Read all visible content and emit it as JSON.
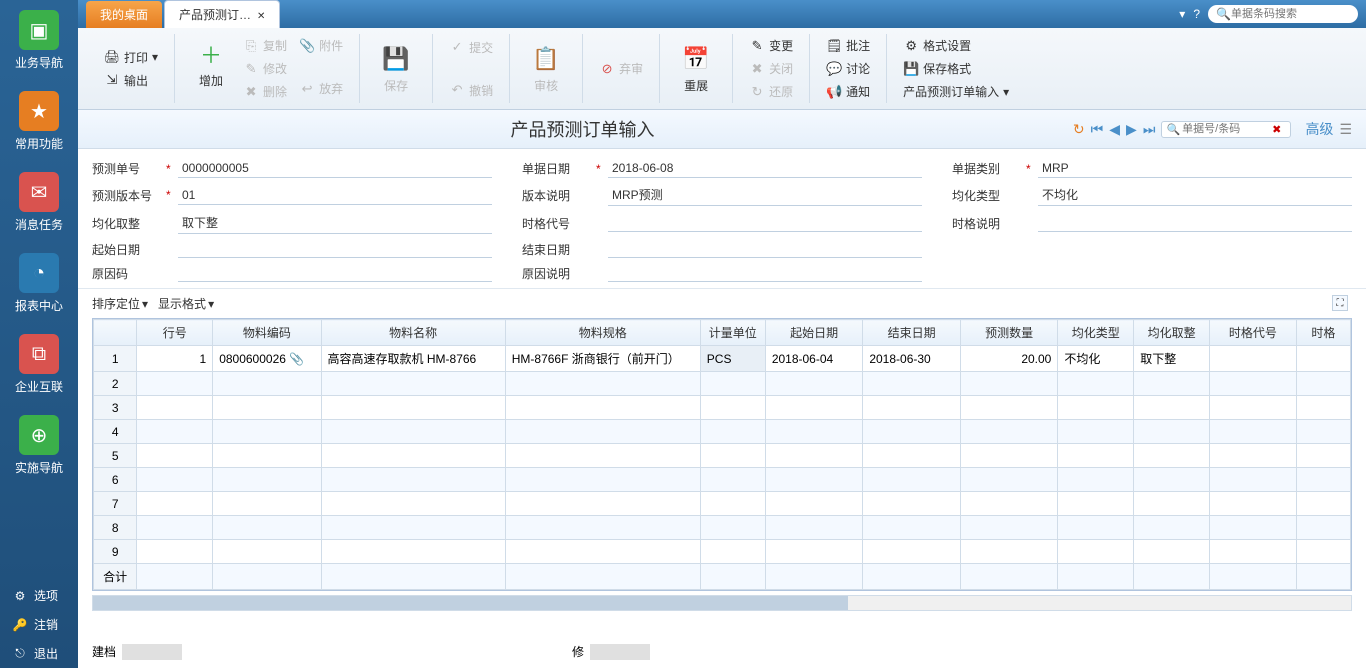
{
  "sidebar": {
    "items": [
      {
        "label": "业务导航",
        "color": "#3bb04a"
      },
      {
        "label": "常用功能",
        "color": "#e67e22"
      },
      {
        "label": "消息任务",
        "color": "#d9534f"
      },
      {
        "label": "报表中心",
        "color": "#2a7ab0"
      },
      {
        "label": "企业互联",
        "color": "#d9534f"
      },
      {
        "label": "实施导航",
        "color": "#3bb04a"
      }
    ],
    "bottom": [
      {
        "label": "选项"
      },
      {
        "label": "注销"
      },
      {
        "label": "退出"
      }
    ]
  },
  "tabs": {
    "desktop": "我的桌面",
    "current": "产品预测订…"
  },
  "topsearch": {
    "placeholder": "单据条码搜索"
  },
  "ribbon": {
    "print": "打印",
    "export": "输出",
    "add": "增加",
    "copy": "复制",
    "modify": "修改",
    "delete": "删除",
    "attach": "附件",
    "discard": "放弃",
    "save": "保存",
    "submit": "提交",
    "recall": "撤销",
    "audit": "审核",
    "reject": "弃审",
    "reexpand": "重展",
    "change": "变更",
    "close": "关闭",
    "restore": "还原",
    "note": "批注",
    "discuss": "讨论",
    "notify": "通知",
    "fmtset": "格式设置",
    "fmtsave": "保存格式",
    "more": "产品预测订单输入"
  },
  "page": {
    "title": "产品预测订单输入"
  },
  "nav": {
    "search_placeholder": "单据号/条码",
    "advanced": "高级"
  },
  "form": {
    "order_no_label": "预测单号",
    "order_no": "0000000005",
    "doc_date_label": "单据日期",
    "doc_date": "2018-06-08",
    "doc_type_label": "单据类别",
    "doc_type": "MRP",
    "ver_no_label": "预测版本号",
    "ver_no": "01",
    "ver_desc_label": "版本说明",
    "ver_desc": "MRP预测",
    "avg_type_label": "均化类型",
    "avg_type": "不均化",
    "avg_round_label": "均化取整",
    "avg_round": "取下整",
    "period_code_label": "时格代号",
    "period_code": "",
    "period_desc_label": "时格说明",
    "period_desc": "",
    "start_date_label": "起始日期",
    "start_date": "",
    "end_date_label": "结束日期",
    "end_date": "",
    "reason_code_label": "原因码",
    "reason_code": "",
    "reason_desc_label": "原因说明",
    "reason_desc": ""
  },
  "gridtools": {
    "sort": "排序定位",
    "format": "显示格式"
  },
  "grid": {
    "cols": [
      "行号",
      "物料编码",
      "物料名称",
      "物料规格",
      "计量单位",
      "起始日期",
      "结束日期",
      "预测数量",
      "均化类型",
      "均化取整",
      "时格代号",
      "时格"
    ],
    "rows": [
      {
        "n": "1",
        "line": "1",
        "code": "0800600026",
        "name": "高容高速存取款机 HM-8766",
        "spec": "HM-8766F 浙商银行（前开门）",
        "uom": "PCS",
        "start": "2018-06-04",
        "end": "2018-06-30",
        "qty": "20.00",
        "avgtype": "不均化",
        "avground": "取下整",
        "period": "",
        "period2": ""
      }
    ],
    "empty_rows": [
      "2",
      "3",
      "4",
      "5",
      "6",
      "7",
      "8",
      "9"
    ],
    "total_label": "合计"
  },
  "footer": {
    "created": "建档",
    "modified": "修"
  }
}
